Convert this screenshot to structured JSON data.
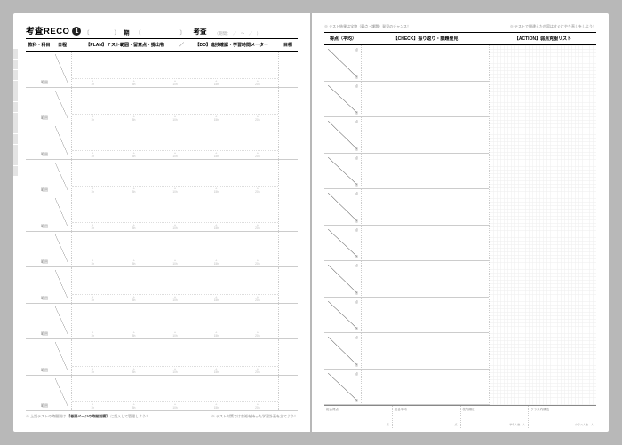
{
  "left": {
    "title": "考査RECO",
    "number": "1",
    "term_open": "〔",
    "term_close": "〕",
    "term_suffix": "期",
    "exam_open": "〔",
    "exam_close": "〕",
    "exam_suffix": "考査",
    "period_hint": "（期間：　／　～　／　）",
    "cols": {
      "subject": "教科・科目",
      "date": "日程",
      "plan": "【PLAN】テスト範囲・留意点・提出物",
      "slash": "／",
      "do": "【DO】進捗確認・学習時間メーター",
      "goal": "目標"
    },
    "row": {
      "range_label": "範囲",
      "meter_labels": [
        "1h",
        "5h",
        "10h",
        "15h",
        "20h"
      ],
      "left_hint": "0",
      "right_hint": "20+"
    },
    "row_count": 10,
    "footer_left_prefix": "※ 上記テストの時間割は",
    "footer_left_bold": "【巻頭ページの時間割欄】",
    "footer_left_suffix": "に記入して管理しよう！",
    "footer_right": "※ テスト対策では余裕を持った学習計画を立てよう！"
  },
  "right": {
    "tip_left": "※ テスト結果は宝物（弱点・課題）発見のチャンス！",
    "tip_right": "※ テストで間違えた内容はすぐにやり直しをしよう！",
    "cols": {
      "score": "得点（平均）",
      "check": "【CHECK】振り返り・課題発見",
      "action": "【ACTION】弱点克服リスト"
    },
    "score_pt_top": "点",
    "score_pt_bottom": "点",
    "row_count": 10,
    "bottom": [
      {
        "label": "総合得点",
        "sublabel": "点"
      },
      {
        "label": "総合平均",
        "sublabel": "点"
      },
      {
        "label": "校内順位",
        "sublabel": "学年人数　人"
      },
      {
        "label": "クラス内順位",
        "sublabel": "クラス人数　人"
      }
    ]
  }
}
